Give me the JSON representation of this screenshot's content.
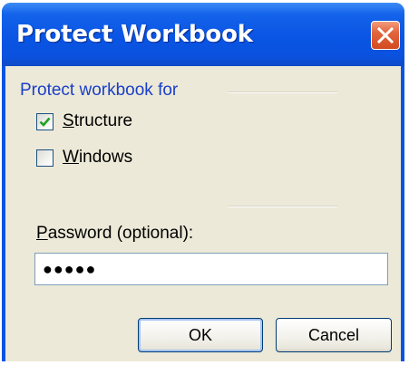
{
  "dialog": {
    "title": "Protect Workbook",
    "close_icon": "close-icon"
  },
  "group": {
    "label": "Protect workbook for"
  },
  "options": [
    {
      "label": "Structure",
      "accel": "S",
      "rest": "tructure",
      "checked": true
    },
    {
      "label": "Windows",
      "accel": "W",
      "rest": "indows",
      "checked": false
    }
  ],
  "password": {
    "label": "Password (optional):",
    "accel": "P",
    "rest": "assword (optional):",
    "value": "●●●●●"
  },
  "buttons": {
    "ok": "OK",
    "cancel": "Cancel"
  },
  "colors": {
    "titlebar": "#0a55e4",
    "close": "#d34a1f",
    "face": "#ece9d8",
    "group_label": "#1a3fc8"
  }
}
